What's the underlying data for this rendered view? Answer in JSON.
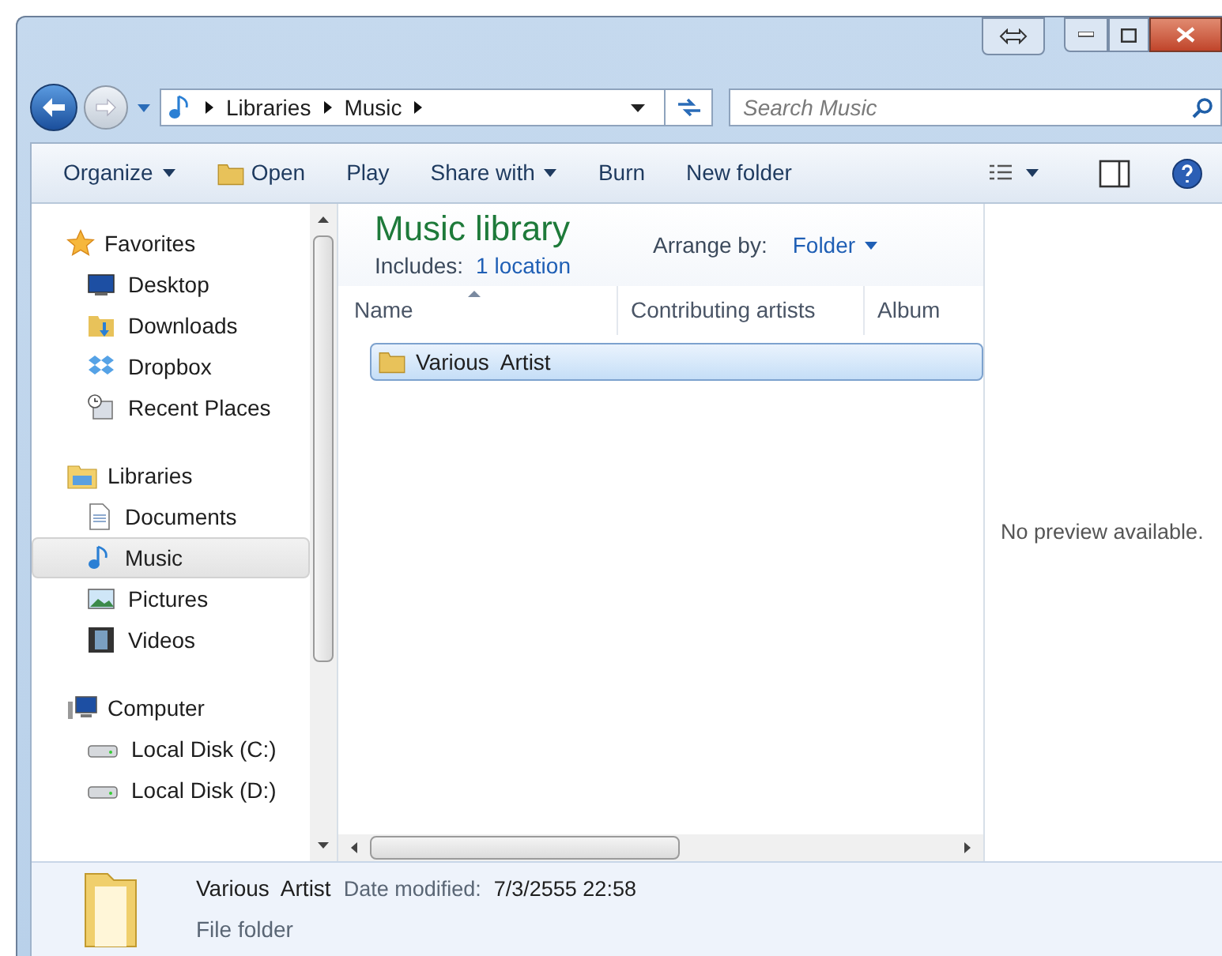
{
  "address_bar": {
    "segments": [
      "Libraries",
      "Music"
    ],
    "search_placeholder": "Search Music"
  },
  "toolbar": {
    "items": [
      {
        "label": "Organize",
        "kind": "menu"
      },
      {
        "label": "Open",
        "kind": "open"
      },
      {
        "label": "Play",
        "kind": "plain"
      },
      {
        "label": "Share with",
        "kind": "menu"
      },
      {
        "label": "Burn",
        "kind": "plain"
      },
      {
        "label": "New folder",
        "kind": "plain"
      }
    ]
  },
  "navigation": [
    {
      "label": "Favorites",
      "kind": "star",
      "children": [
        {
          "label": "Desktop",
          "kind": "desktop",
          "selected": false
        },
        {
          "label": "Downloads",
          "kind": "downloads",
          "selected": false
        },
        {
          "label": "Dropbox",
          "kind": "dropbox",
          "selected": false
        },
        {
          "label": "Recent Places",
          "kind": "recent",
          "selected": false
        }
      ]
    },
    {
      "label": "Libraries",
      "kind": "libraries",
      "children": [
        {
          "label": "Documents",
          "kind": "documents",
          "selected": false
        },
        {
          "label": "Music",
          "kind": "music",
          "selected": true
        },
        {
          "label": "Pictures",
          "kind": "pictures",
          "selected": false
        },
        {
          "label": "Videos",
          "kind": "videos",
          "selected": false
        }
      ]
    },
    {
      "label": "Computer",
      "kind": "computer",
      "children": [
        {
          "label": "Local Disk (C:)",
          "kind": "disk",
          "selected": false
        },
        {
          "label": "Local Disk (D:)",
          "kind": "disk",
          "selected": false
        }
      ]
    }
  ],
  "library": {
    "title": "Music library",
    "includes_label": "Includes:",
    "includes_link": "1 location",
    "arrange_label": "Arrange by:",
    "arrange_value": "Folder"
  },
  "table": {
    "columns": [
      "Name",
      "Contributing artists",
      "Album"
    ],
    "rows": [
      {
        "name": "Various  Artist",
        "selected": true
      }
    ]
  },
  "preview": {
    "message": "No preview available."
  },
  "details": {
    "name": "Various  Artist",
    "date_label": "Date modified:",
    "date_value": "7/3/2555 22:58",
    "type": "File folder"
  }
}
